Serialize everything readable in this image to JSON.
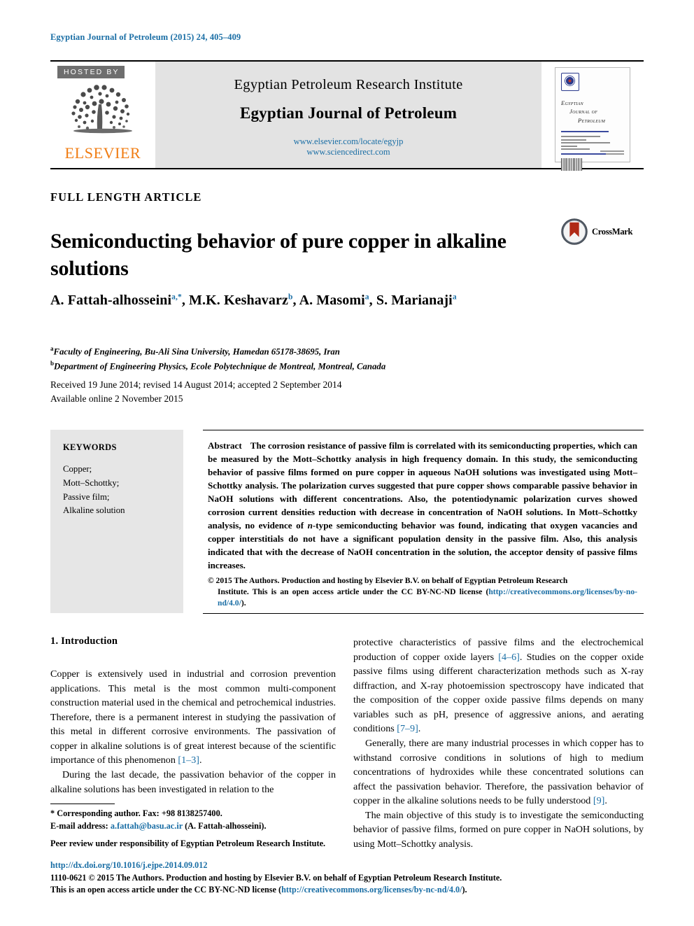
{
  "running_head": "Egyptian Journal of Petroleum (2015) 24, 405–409",
  "masthead": {
    "hosted_by": "HOSTED BY",
    "publisher_wordmark": "ELSEVIER",
    "institute": "Egyptian Petroleum Research Institute",
    "journal": "Egyptian Journal of Petroleum",
    "link_locate": "www.elsevier.com/locate/egyjp",
    "link_sciencedirect": "www.sciencedirect.com",
    "cover": {
      "line1": "Egyptian",
      "line2": "Journal of",
      "line3": "Petroleum"
    }
  },
  "article": {
    "type": "FULL LENGTH ARTICLE",
    "title": "Semiconducting behavior of pure copper in alkaline solutions",
    "crossmark_label": "CrossMark",
    "authors": [
      {
        "name": "A. Fattah-alhosseini",
        "marks": "a,*"
      },
      {
        "name": "M.K. Keshavarz",
        "marks": "b"
      },
      {
        "name": "A. Masomi",
        "marks": "a"
      },
      {
        "name": "S. Marianaji",
        "marks": "a"
      }
    ],
    "affiliations": [
      {
        "mark": "a",
        "text": "Faculty of Engineering, Bu-Ali Sina University, Hamedan 65178-38695, Iran"
      },
      {
        "mark": "b",
        "text": "Department of Engineering Physics, Ecole Polytechnique de Montreal, Montreal, Canada"
      }
    ],
    "dates_received": "Received 19 June 2014; revised 14 August 2014; accepted 2 September 2014",
    "dates_online": "Available online 2 November 2015"
  },
  "keywords": {
    "title": "KEYWORDS",
    "items": [
      "Copper;",
      "Mott–Schottky;",
      "Passive film;",
      "Alkaline solution"
    ]
  },
  "abstract": {
    "label": "Abstract",
    "text_part1": "The corrosion resistance of passive film is correlated with its semiconducting properties, which can be measured by the Mott–Schottky analysis in high frequency domain. In this study, the semiconducting behavior of passive films formed on pure copper in aqueous NaOH solutions was investigated using Mott–Schottky analysis. The polarization curves suggested that pure copper shows comparable passive behavior in NaOH solutions with different concentrations. Also, the potentiodynamic polarization curves showed corrosion current densities reduction with decrease in concentration of NaOH solutions. In Mott–Schottky analysis, no evidence of ",
    "italic_n": "n",
    "text_part2": "-type semiconducting behavior was found, indicating that oxygen vacancies and copper interstitials do not have a significant population density in the passive film. Also, this analysis indicated that with the decrease of NaOH concentration in the solution, the acceptor density of passive films increases.",
    "copyright_line1": "© 2015 The Authors. Production and hosting by Elsevier B.V. on behalf of Egyptian Petroleum Research",
    "copyright_line2_a": "Institute.  This is an open access article under the CC BY-NC-ND license (",
    "copyright_link1": "http://creativecommons.org/",
    "copyright_link2": "licenses/by-no-nd/4.0/",
    "copyright_line2_b": ")."
  },
  "body": {
    "section_title": "1. Introduction",
    "left_para1": "Copper is extensively used in industrial and corrosion prevention applications. This metal is the most common multi-component construction material used in the chemical and petrochemical industries. Therefore, there is a permanent interest in studying the passivation of this metal in different corrosive environments. The passivation of copper in alkaline solutions is of great interest because of the scientific importance of this phenomenon ",
    "left_para1_ref": "[1–3]",
    "left_para1_end": ".",
    "left_para2": "During the last decade, the passivation behavior of the copper in alkaline solutions has been investigated in relation to the",
    "right_para1_a": "protective characteristics of passive films and the electrochemical production of copper oxide layers ",
    "right_para1_ref1": "[4–6]",
    "right_para1_b": ". Studies on the copper oxide passive films using different characterization methods such as X-ray diffraction, and X-ray photoemission spectroscopy have indicated that the composition of the copper oxide passive films depends on many variables such as pH, presence of aggressive anions, and aerating conditions ",
    "right_para1_ref2": "[7–9]",
    "right_para1_c": ".",
    "right_para2_a": "Generally, there are many industrial processes in which copper has to withstand corrosive conditions in solutions of high to medium concentrations of hydroxides while these concentrated solutions can affect the passivation behavior. Therefore, the passivation behavior of copper in the alkaline solutions needs to be fully understood ",
    "right_para2_ref": "[9]",
    "right_para2_b": ".",
    "right_para3": "The main objective of this study is to investigate the semiconducting behavior of passive films, formed on pure copper in NaOH solutions, by using Mott–Schottky analysis."
  },
  "footnotes": {
    "corresponding": "* Corresponding author. Fax: +98 8138257400.",
    "email_label": "E-mail address:",
    "email": "a.fattah@basu.ac.ir",
    "email_suffix": "(A. Fattah-alhosseini).",
    "peer_review": "Peer review under responsibility of Egyptian Petroleum Research Institute."
  },
  "footer": {
    "doi": "http://dx.doi.org/10.1016/j.ejpe.2014.09.012",
    "issn_line": "1110-0621 © 2015 The Authors. Production and hosting by Elsevier B.V. on behalf of Egyptian Petroleum Research Institute.",
    "license_prefix": "This is an open access article under the CC BY-NC-ND license (",
    "license_link": "http://creativecommons.org/licenses/by-nc-nd/4.0/",
    "license_suffix": ")."
  },
  "colors": {
    "link_blue": "#1a6ea5",
    "elsevier_orange": "#f07c12",
    "hosted_gray": "#6e6e6e",
    "panel_gray": "#e3e3e3",
    "keyword_gray": "#e6e6e6"
  }
}
